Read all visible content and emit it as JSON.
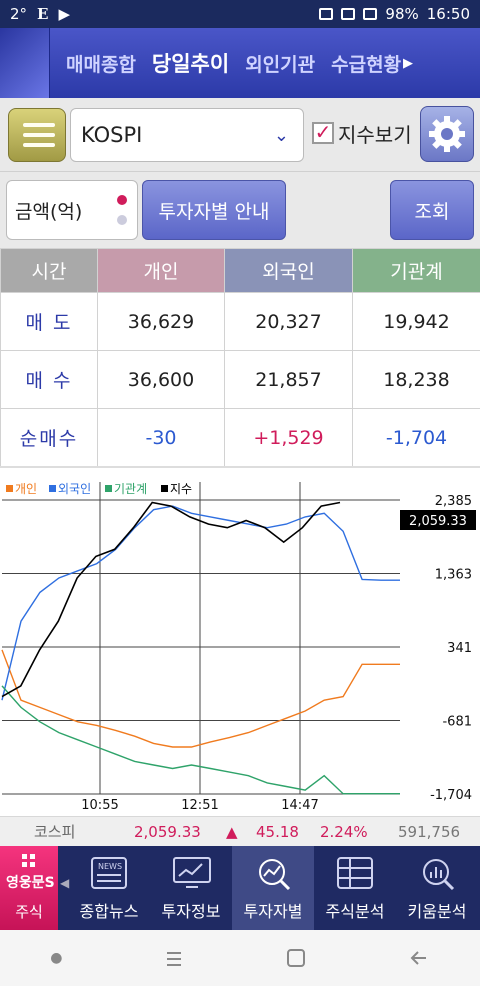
{
  "status": {
    "temp": "2°",
    "left_icons": [
      "E",
      "▶"
    ],
    "battery": "98%",
    "time": "16:50"
  },
  "tabs": [
    {
      "label": "매매종합",
      "active": false
    },
    {
      "label": "당일추이",
      "active": true
    },
    {
      "label": "외인기관",
      "active": false
    },
    {
      "label": "수급현황",
      "active": false
    }
  ],
  "controls": {
    "market": "KOSPI",
    "show_index_label": "지수보기",
    "show_index_checked": true,
    "amount_unit": "금액(억)",
    "guide_label": "투자자별 안내",
    "query_label": "조회"
  },
  "table": {
    "headers": [
      "시간",
      "개인",
      "외국인",
      "기관계"
    ],
    "rows": [
      {
        "label": "매 도",
        "values": [
          "36,629",
          "20,327",
          "19,942"
        ],
        "tone": [
          "",
          "",
          ""
        ]
      },
      {
        "label": "매 수",
        "values": [
          "36,600",
          "21,857",
          "18,238"
        ],
        "tone": [
          "",
          "",
          ""
        ]
      },
      {
        "label": "순매수",
        "values": [
          "-30",
          "+1,529",
          "-1,704"
        ],
        "tone": [
          "neg",
          "pos",
          "neg"
        ]
      }
    ]
  },
  "chart_data": {
    "type": "line",
    "legend": [
      {
        "name": "개인",
        "color": "#f07b1f"
      },
      {
        "name": "외국인",
        "color": "#2f6fe0"
      },
      {
        "name": "기관계",
        "color": "#2fa36a"
      },
      {
        "name": "지수",
        "color": "#000000"
      }
    ],
    "x_ticks": [
      "10:55",
      "12:51",
      "14:47"
    ],
    "y_ticks": [
      "2,385",
      "1,363",
      "341",
      "-681",
      "-1,704"
    ],
    "current_value": "2,059.33",
    "ylim": [
      -1704,
      2385
    ],
    "series": [
      {
        "name": "개인",
        "values": [
          300,
          -400,
          -500,
          -600,
          -700,
          -750,
          -820,
          -900,
          -1000,
          -1050,
          -1050,
          -980,
          -920,
          -850,
          -750,
          -650,
          -550,
          -400,
          -350,
          100,
          100,
          100
        ]
      },
      {
        "name": "외국인",
        "values": [
          -400,
          700,
          1100,
          1300,
          1400,
          1500,
          1700,
          2000,
          2250,
          2300,
          2200,
          2150,
          2100,
          2050,
          2000,
          2050,
          2150,
          2200,
          1950,
          1280,
          1270,
          1270
        ]
      },
      {
        "name": "기관계",
        "values": [
          -200,
          -500,
          -700,
          -850,
          -950,
          -1050,
          -1150,
          -1250,
          -1300,
          -1350,
          -1300,
          -1350,
          -1400,
          -1450,
          -1550,
          -1600,
          -1650,
          -1450,
          -1700,
          -1700,
          -1700,
          -1700
        ]
      },
      {
        "name": "지수",
        "values": [
          -350,
          -200,
          300,
          700,
          1300,
          1600,
          1700,
          2000,
          2350,
          2300,
          2150,
          2050,
          2000,
          2100,
          2000,
          1800,
          2000,
          2300,
          2350
        ]
      }
    ]
  },
  "infobar": {
    "name": "코스피",
    "price": "2,059.33",
    "arrow": "▲",
    "change": "45.18",
    "rate": "2.24%",
    "volume": "591,756"
  },
  "bottom_nav": [
    {
      "label": "주식"
    },
    {
      "label": "종합뉴스"
    },
    {
      "label": "투자정보"
    },
    {
      "label": "투자자별"
    },
    {
      "label": "주식분석"
    },
    {
      "label": "키움분석"
    }
  ],
  "logo_text": "영웅문S"
}
